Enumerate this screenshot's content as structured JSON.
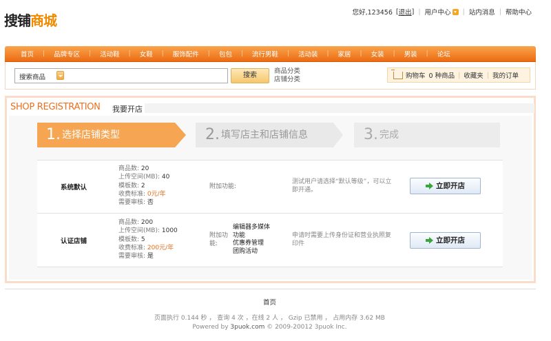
{
  "logo": {
    "part1": "搜铺",
    "part2": "商城"
  },
  "toplinks": {
    "greeting": "您好,123456",
    "logout_open": "[",
    "logout": "退出",
    "logout_close": "]",
    "user_center": "用户中心",
    "messages": "站内消息",
    "help": "帮助中心"
  },
  "nav": [
    "首页",
    "品牌专区",
    "活动鞋",
    "女鞋",
    "服饰配件",
    "包包",
    "流行男鞋",
    "活动装",
    "家居",
    "女装",
    "男装",
    "论坛"
  ],
  "search": {
    "scope_label": "搜索商品",
    "input_value": "",
    "button": "搜索",
    "type1": "商品分类",
    "type2": "店铺分类"
  },
  "cart": {
    "label": "购物车",
    "count": "0 种商品",
    "favorites": "收藏夹",
    "orders": "我的订单"
  },
  "page": {
    "title_en": "SHOP REGISTRATION",
    "title_cn": "我要开店"
  },
  "steps": [
    {
      "num": "1.",
      "label": "选择店铺类型"
    },
    {
      "num": "2.",
      "label": "填写店主和店铺信息"
    },
    {
      "num": "3.",
      "label": "完成"
    }
  ],
  "plans": [
    {
      "name": "系统默认",
      "specs": {
        "goods_label": "商品数:",
        "goods": "20",
        "space_label": "上传空间(MB):",
        "space": "40",
        "tpl_label": "模板数:",
        "tpl": "2",
        "fee_label": "收费标准:",
        "fee": "0元/年",
        "review_label": "需要审核:",
        "review": "否"
      },
      "feature_label": "附加功能:",
      "features": [],
      "note": "测试用户请选择“默认等级”，可以立即开通。",
      "button": "立即开店"
    },
    {
      "name": "认证店铺",
      "specs": {
        "goods_label": "商品数:",
        "goods": "200",
        "space_label": "上传空间(MB):",
        "space": "1000",
        "tpl_label": "模板数:",
        "tpl": "5",
        "fee_label": "收费标准:",
        "fee": "200元/年",
        "review_label": "需要审核:",
        "review": "是"
      },
      "feature_label_1": "附加功",
      "feature_label_2": "能:",
      "features": [
        "编辑器多媒体",
        "功能",
        "优惠券管理",
        "团购活动"
      ],
      "note": "申请时需要上传身份证和营业执照复印件",
      "button": "立即开店"
    }
  ],
  "footer": {
    "home": "首页",
    "stats": "页面执行 0.144 秒 ， 查询 4 次 ，在线 2 人 ， Gzip 已禁用 ， 占用内存 3.62 MB",
    "powered_prefix": "Powered by ",
    "powered_link": "3puok.com",
    "powered_suffix": " © 2009-20012 3puok Inc."
  }
}
